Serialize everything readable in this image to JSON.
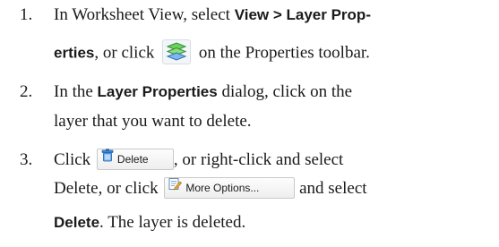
{
  "steps": [
    {
      "number": "1.",
      "l1_a": "In Worksheet View, select ",
      "l1_b": "View > Layer Prop-",
      "l2_a": "erties",
      "l2_b": ", or click ",
      "l2_c": " on the Properties toolbar."
    },
    {
      "number": "2.",
      "l1_a": "In the ",
      "l1_b": "Layer Properties",
      "l1_c": " dialog, click on the",
      "l2": "layer that you want to delete."
    },
    {
      "number": "3.",
      "l1_a": "Click ",
      "l1_c": ", or right-click and select",
      "l2_a": "Delete, or click ",
      "l2_c": " and select",
      "l3_a": "Delete",
      "l3_b": ". The layer is deleted."
    }
  ],
  "buttons": {
    "delete_label": "Delete",
    "more_options_label": "More Options..."
  },
  "icons": {
    "layer_properties": "layer-properties-icon",
    "delete": "trash-can-icon",
    "more_options": "edit-document-icon"
  },
  "colors": {
    "text": "#1a1a1a",
    "layer_icon_green": "#3cae4a",
    "layer_icon_blue": "#2f7fd0",
    "trash_blue": "#2a6fc4"
  }
}
